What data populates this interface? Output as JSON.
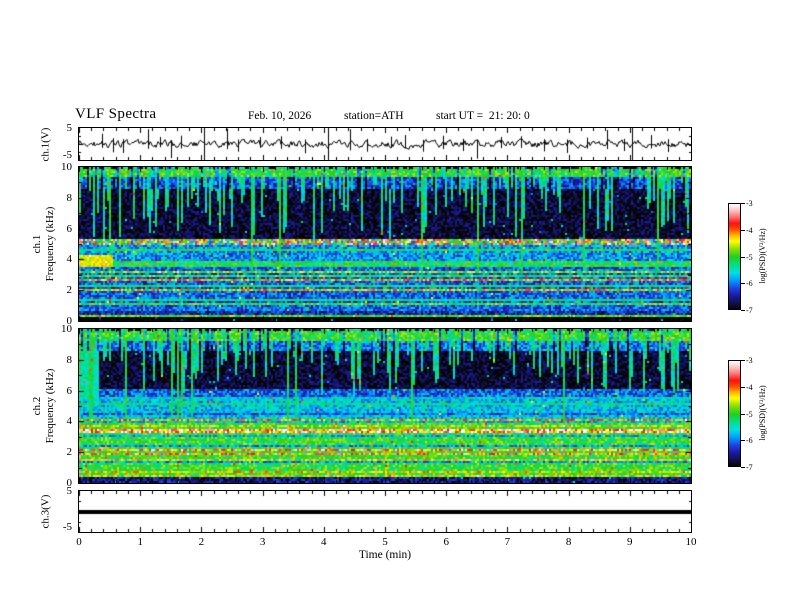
{
  "title": {
    "main": "VLF Spectra",
    "date": "Feb. 10, 2026",
    "station": "station=ATH",
    "start_ut": "start UT =  21: 20: 0"
  },
  "chart_data": {
    "type": "heatmap",
    "xaxis": {
      "label": "Time (min)",
      "min": 0,
      "max": 10,
      "ticks": [
        0,
        1,
        2,
        3,
        4,
        5,
        6,
        7,
        8,
        9,
        10
      ],
      "minor_step": 0.2
    },
    "colorbar": {
      "label": "log(PSD)(V²/Hz)",
      "min": -7,
      "max": -3,
      "ticks": [
        -3,
        -4,
        -5,
        -6,
        -7
      ]
    },
    "colormap": {
      "stops": [
        [
          0.0,
          "#050505"
        ],
        [
          0.06,
          "#10104a"
        ],
        [
          0.13,
          "#1a1aa0"
        ],
        [
          0.2,
          "#2040e0"
        ],
        [
          0.28,
          "#00a0ff"
        ],
        [
          0.35,
          "#00e0e0"
        ],
        [
          0.42,
          "#00e090"
        ],
        [
          0.5,
          "#20d020"
        ],
        [
          0.58,
          "#90e000"
        ],
        [
          0.65,
          "#ffff00"
        ],
        [
          0.71,
          "#ffb000"
        ],
        [
          0.76,
          "#ff5000"
        ],
        [
          0.82,
          "#ff1010"
        ],
        [
          0.88,
          "#ff7070"
        ],
        [
          0.94,
          "#ffc0c0"
        ],
        [
          1.0,
          "#ffffff"
        ]
      ]
    },
    "panels": [
      {
        "id": "ch1wave",
        "type": "line",
        "ylabel": "ch.1(V)",
        "ymin": -5,
        "ymax": 5,
        "yticks": [
          5,
          -5
        ],
        "noise_v": 0.5,
        "spikes": [
          [
            0.38,
            3.2,
            1.2
          ],
          [
            0.55,
            1.8,
            2.6
          ],
          [
            0.72,
            1.5,
            2.8
          ],
          [
            1.12,
            4.6,
            1.5
          ],
          [
            1.33,
            2.2,
            1.0
          ],
          [
            1.5,
            1.2,
            4.4
          ],
          [
            1.66,
            2.6,
            1.4
          ],
          [
            2.05,
            6,
            6
          ],
          [
            2.42,
            4.8,
            1.6
          ],
          [
            2.6,
            1.4,
            2.4
          ],
          [
            2.95,
            2.2,
            1.2
          ],
          [
            3.3,
            2.4,
            1.5
          ],
          [
            3.7,
            1.4,
            2.9
          ],
          [
            4.07,
            6,
            6
          ],
          [
            4.42,
            4.6,
            2.0
          ],
          [
            4.7,
            1.6,
            2.4
          ],
          [
            5.1,
            2.3,
            1.2
          ],
          [
            5.33,
            2.8,
            1.4
          ],
          [
            5.62,
            1.3,
            2.4
          ],
          [
            5.95,
            2.6,
            1.6
          ],
          [
            6.28,
            1.6,
            2.2
          ],
          [
            6.5,
            1.4,
            4.6
          ],
          [
            6.9,
            2.2,
            1.3
          ],
          [
            7.22,
            2.4,
            1.2
          ],
          [
            7.6,
            1.5,
            2.3
          ],
          [
            7.97,
            1.4,
            2.8
          ],
          [
            8.3,
            2.0,
            1.4
          ],
          [
            8.62,
            4.4,
            1.6
          ],
          [
            8.9,
            1.6,
            2.2
          ],
          [
            9.03,
            6,
            6
          ],
          [
            9.35,
            2.8,
            1.4
          ],
          [
            9.62,
            1.5,
            2.5
          ]
        ]
      },
      {
        "id": "ch1spec",
        "type": "heatmap",
        "ylabel_line1": "ch.1",
        "ylabel_line2": "Frequency (kHz)",
        "ymin": 0,
        "ymax": 10,
        "yticks": [
          0,
          2,
          4,
          6,
          8,
          10
        ],
        "base_profile": [
          [
            0,
            0.3,
            -7.2
          ],
          [
            0.3,
            0.48,
            -4.9
          ],
          [
            0.48,
            0.7,
            -6.4
          ],
          [
            0.7,
            3.6,
            -6.1
          ],
          [
            3.6,
            4.0,
            -5.15
          ],
          [
            4.0,
            5.05,
            -5.9
          ],
          [
            5.05,
            8.6,
            -6.9
          ],
          [
            8.6,
            9.4,
            -6.2
          ],
          [
            9.4,
            10,
            -5.0
          ]
        ],
        "hlines": [
          [
            0.85,
            -5.4,
            0.05,
            0.4
          ],
          [
            1.15,
            -5.0,
            0.06,
            0.5
          ],
          [
            1.45,
            -5.3,
            0.05,
            0.4
          ],
          [
            1.75,
            -4.8,
            0.06,
            0.5
          ],
          [
            2.05,
            -4.5,
            0.06,
            0.7
          ],
          [
            2.35,
            -5.2,
            0.05,
            0.4
          ],
          [
            2.7,
            -4.3,
            0.05,
            0.9
          ],
          [
            3.0,
            -5.0,
            0.05,
            0.5
          ],
          [
            3.3,
            -4.8,
            0.06,
            0.5
          ],
          [
            4.35,
            -5.3,
            0.05,
            0.4
          ],
          [
            4.7,
            -5.15,
            0.05,
            0.4
          ],
          [
            5.25,
            -4.6,
            0.2,
            1.6
          ]
        ],
        "streaks": {
          "fmin": 5.2,
          "density": 0.6,
          "level": -5.35,
          "full_prob": 0.02
        },
        "features": [
          {
            "t0": 0,
            "t1": 0.55,
            "f0": 3.6,
            "f1": 4.35,
            "level": -4.4
          }
        ]
      },
      {
        "id": "ch2spec",
        "type": "heatmap",
        "ylabel_line1": "ch.2",
        "ylabel_line2": "Frequency (kHz)",
        "ymin": 0,
        "ymax": 10,
        "yticks": [
          0,
          2,
          4,
          6,
          8,
          10
        ],
        "base_profile": [
          [
            0,
            0.05,
            -7.1
          ],
          [
            0.05,
            0.12,
            -4.2
          ],
          [
            0.12,
            0.5,
            -6.6
          ],
          [
            0.5,
            4.0,
            -5.0
          ],
          [
            4.0,
            5.5,
            -5.7
          ],
          [
            5.5,
            6.2,
            -6.1
          ],
          [
            6.2,
            8.6,
            -6.9
          ],
          [
            8.6,
            9.3,
            -6.0
          ],
          [
            9.3,
            10,
            -5.0
          ]
        ],
        "hlines": [
          [
            0.55,
            -4.6,
            0.05,
            0.5
          ],
          [
            0.8,
            -4.4,
            0.05,
            0.5
          ],
          [
            1.1,
            -4.3,
            0.06,
            0.6
          ],
          [
            1.4,
            -5.9,
            0.04,
            0.4
          ],
          [
            1.6,
            -4.5,
            0.05,
            0.5
          ],
          [
            1.9,
            -4.1,
            0.06,
            0.8
          ],
          [
            2.2,
            -3.9,
            0.07,
            0.9
          ],
          [
            2.5,
            -5.9,
            0.04,
            0.4
          ],
          [
            2.8,
            -4.6,
            0.05,
            0.5
          ],
          [
            3.1,
            -5.8,
            0.04,
            0.4
          ],
          [
            3.4,
            -3.7,
            0.12,
            1.0
          ],
          [
            3.75,
            -4.5,
            0.05,
            0.5
          ],
          [
            4.2,
            -4.3,
            0.06,
            0.8
          ],
          [
            4.55,
            -6.1,
            0.05,
            0.4
          ],
          [
            4.85,
            -5.0,
            0.04,
            0.4
          ],
          [
            5.2,
            -5.3,
            0.05,
            0.4
          ],
          [
            5.55,
            -5.6,
            0.04,
            0.4
          ]
        ],
        "streaks": {
          "fmin": 5.8,
          "density": 0.6,
          "level": -5.35,
          "full_prob": 0.03
        },
        "features": [
          {
            "t0": 0,
            "t1": 0.3,
            "f0": 5.5,
            "f1": 9.3,
            "level": -5.4
          }
        ]
      },
      {
        "id": "ch3wave",
        "type": "line",
        "ylabel": "ch.3(V)",
        "ymin": -5,
        "ymax": 5,
        "yticks": [
          5,
          -5
        ],
        "flat_value": 0,
        "line_width": 4
      }
    ]
  }
}
